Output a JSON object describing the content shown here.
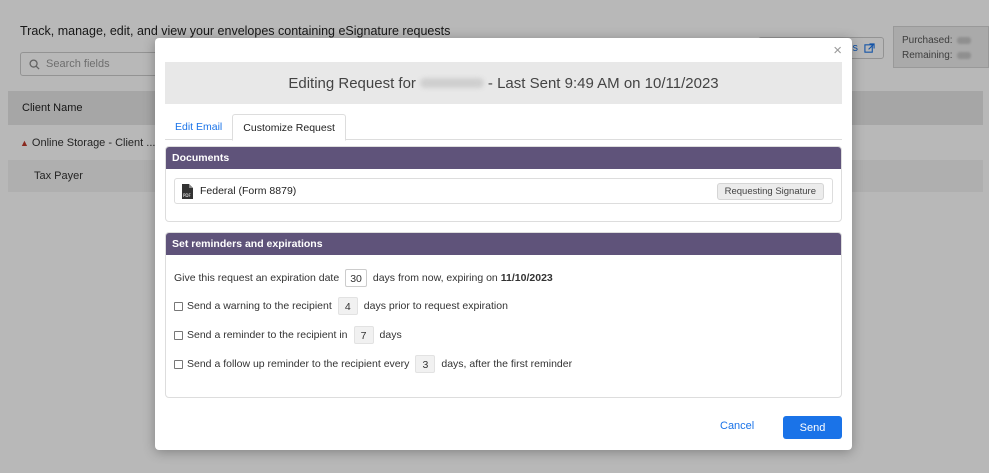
{
  "background": {
    "page_title": "Track, manage, edit, and view your envelopes containing eSignature requests",
    "search_placeholder": "Search fields",
    "table_header": "Client Name",
    "rows": [
      "Online Storage - Client ...",
      "Tax Payer"
    ],
    "link_text": "s",
    "purchased_label": "Purchased:",
    "remaining_label": "Remaining:"
  },
  "modal": {
    "close": "×",
    "title_prefix": "Editing Request for",
    "title_suffix": "- Last Sent 9:49 AM on 10/11/2023",
    "tabs": [
      "Edit Email",
      "Customize Request"
    ],
    "active_tab": "Customize Request",
    "documents": {
      "header": "Documents",
      "items": [
        {
          "name": "Federal (Form 8879)",
          "status": "Requesting Signature"
        }
      ]
    },
    "reminders": {
      "header": "Set reminders and expirations",
      "expiration": {
        "prefix": "Give this request an expiration date",
        "days": "30",
        "middle": "days from now, expiring on",
        "date": "11/10/2023"
      },
      "warning": {
        "prefix": "Send a warning to the recipient",
        "days": "4",
        "suffix": "days prior to request expiration",
        "checked": false
      },
      "reminder": {
        "prefix": "Send a reminder to the recipient in",
        "days": "7",
        "suffix": "days",
        "checked": false
      },
      "followup": {
        "prefix": "Send a follow up reminder to the recipient every",
        "days": "3",
        "suffix": "days, after the first reminder",
        "checked": false
      }
    },
    "cancel_label": "Cancel",
    "send_label": "Send"
  },
  "colors": {
    "panel_header": "#5f537a",
    "primary": "#1a73e8"
  }
}
